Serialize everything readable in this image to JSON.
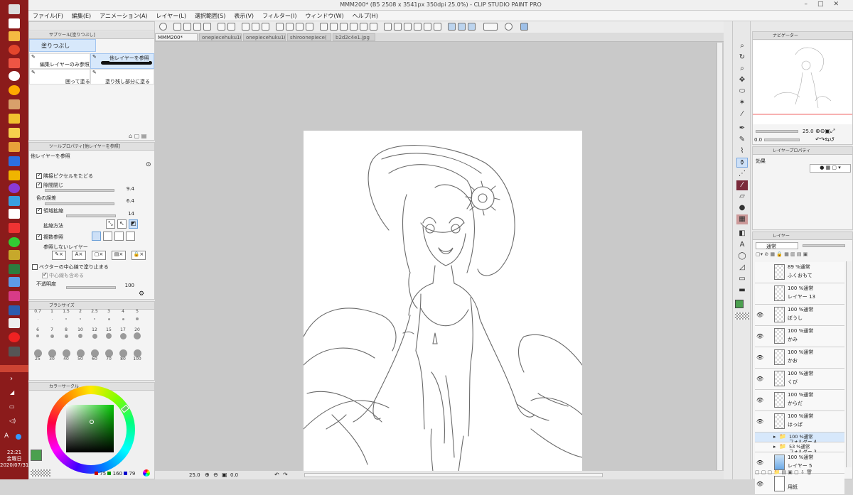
{
  "window": {
    "title": "MMM200* (B5 2508 x 3541px 350dpi 25.0%) - CLIP STUDIO PAINT PRO"
  },
  "menu": [
    "ファイル(F)",
    "編集(E)",
    "アニメーション(A)",
    "レイヤー(L)",
    "選択範囲(S)",
    "表示(V)",
    "フィルター(I)",
    "ウィンドウ(W)",
    "ヘルプ(H)"
  ],
  "tabs": [
    "MMM200*",
    "onepiecehuku1(",
    "onepiecehuku1(",
    "shiroonepiece(",
    "b2d2c4e1.jpg"
  ],
  "subtool": {
    "header": "サブツール[塗りつぶし]",
    "group": "塗りつぶし",
    "items": [
      "編集レイヤーのみ参照",
      "他レイヤーを参照",
      "囲って塗る",
      "塗り残し部分に塗る"
    ]
  },
  "toolprop": {
    "header": "ツールプロパティ[他レイヤーを参照]",
    "name": "他レイヤーを参照",
    "adjacent_pixels": "隣接ピクセルをたどる",
    "close_gap": "隙間閉じ",
    "close_gap_val": "9.4",
    "color_margin": "色の誤差",
    "color_margin_val": "6.4",
    "expand": "領域拡縮",
    "expand_val": "14",
    "expand_method": "拡縮方法",
    "multi_ref": "複数参照",
    "no_ref_layer": "参照しないレイヤー",
    "vector_stop": "ベクターの中心線で塗り止まる",
    "include_center": "中心線も含める",
    "opacity": "不透明度",
    "opacity_val": "100"
  },
  "brushsize": {
    "header": "ブラシサイズ",
    "sizes": [
      "0.7",
      "1",
      "1.5",
      "2",
      "2.5",
      "3",
      "4",
      "5",
      "6",
      "7",
      "8",
      "10",
      "12",
      "15",
      "17",
      "20",
      "25",
      "30",
      "40",
      "50",
      "60",
      "70",
      "80",
      "100"
    ]
  },
  "colorcircle": {
    "header": "カラーサークル",
    "r": "75",
    "g": "160",
    "b": "79",
    "main_color": "#4ba04f"
  },
  "navigator": {
    "header": "ナビゲーター",
    "zoom": "25.0",
    "angle": "0.0"
  },
  "layerprop": {
    "header": "レイヤープロパティ",
    "effect": "効果"
  },
  "layers": {
    "header": "レイヤー",
    "blend": "通常",
    "items": [
      {
        "l1": "89 %通常",
        "l2": "ふくおもて"
      },
      {
        "l1": "100 %通常",
        "l2": "レイヤー 13"
      },
      {
        "l1": "100 %通常",
        "l2": "ぼうし"
      },
      {
        "l1": "100 %通常",
        "l2": "かみ"
      },
      {
        "l1": "100 %通常",
        "l2": "かお"
      },
      {
        "l1": "100 %通常",
        "l2": "くび"
      },
      {
        "l1": "100 %通常",
        "l2": "からだ"
      },
      {
        "l1": "100 %通常",
        "l2": "はっぱ"
      },
      {
        "l1": "100 %通常",
        "l2": "フォルダー 4"
      },
      {
        "l1": "53 %通常",
        "l2": "フォルダー 3"
      },
      {
        "l1": "100 %通常",
        "l2": "レイヤー 5"
      },
      {
        "l1": "",
        "l2": "用紙"
      }
    ]
  },
  "status": {
    "zoom": "25.0",
    "angle": "0.0"
  },
  "clock": {
    "time": "22:21",
    "day": "金曜日",
    "date": "2020/07/31"
  }
}
